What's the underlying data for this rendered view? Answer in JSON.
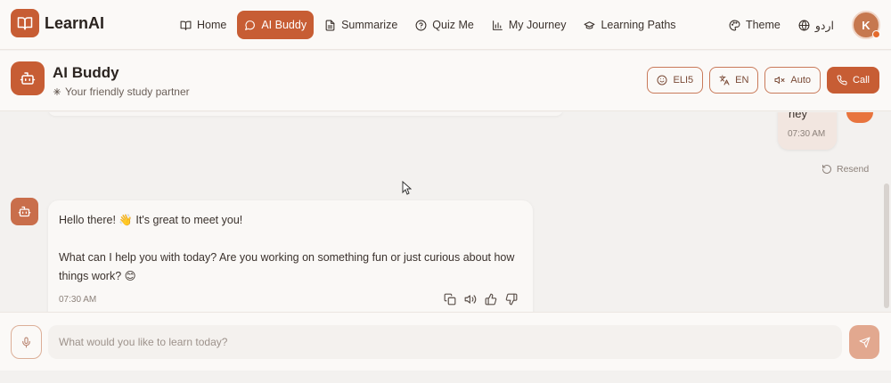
{
  "app": {
    "name": "LearnAI"
  },
  "nav": {
    "items": [
      {
        "label": "Home",
        "icon": "book-open-icon",
        "active": false
      },
      {
        "label": "AI Buddy",
        "icon": "chat-bubble-icon",
        "active": true
      },
      {
        "label": "Summarize",
        "icon": "document-icon",
        "active": false
      },
      {
        "label": "Quiz Me",
        "icon": "help-circle-icon",
        "active": false
      },
      {
        "label": "My Journey",
        "icon": "bar-chart-icon",
        "active": false
      },
      {
        "label": "Learning Paths",
        "icon": "graduation-cap-icon",
        "active": false
      }
    ],
    "theme_label": "Theme",
    "language_label": "اردو",
    "avatar_initial": "K"
  },
  "chat_header": {
    "title": "AI Buddy",
    "subtitle": "Your friendly study partner",
    "buttons": {
      "eli5": "ELI5",
      "lang": "EN",
      "auto": "Auto",
      "call": "Call"
    }
  },
  "messages": {
    "user": {
      "text": "hey",
      "time": "07:30 AM",
      "resend_label": "Resend"
    },
    "bot": {
      "line1": "Hello there! 👋  It's great to meet you!",
      "line2": "What can I help you with today? Are you working on something fun or just curious about how things work? 😊",
      "time": "07:30 AM"
    }
  },
  "composer": {
    "placeholder": "What would you like to learn today?"
  },
  "colors": {
    "accent": "#c75d34",
    "background": "#f3f1ef",
    "surface": "#fbf9f7"
  }
}
